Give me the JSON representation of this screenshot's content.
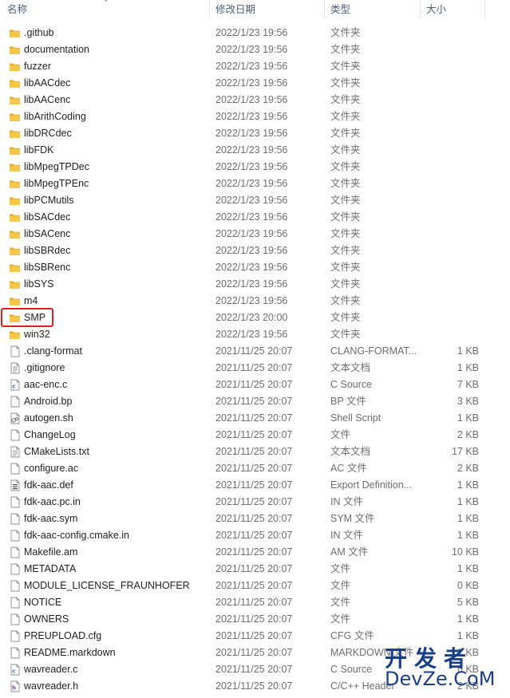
{
  "columns": {
    "name": "名称",
    "modified": "修改日期",
    "type": "类型",
    "size": "大小"
  },
  "files": [
    {
      "name": ".github",
      "date": "2022/1/23 19:56",
      "type": "文件夹",
      "size": "",
      "icon": "folder-icon"
    },
    {
      "name": "documentation",
      "date": "2022/1/23 19:56",
      "type": "文件夹",
      "size": "",
      "icon": "folder-icon"
    },
    {
      "name": "fuzzer",
      "date": "2022/1/23 19:56",
      "type": "文件夹",
      "size": "",
      "icon": "folder-icon"
    },
    {
      "name": "libAACdec",
      "date": "2022/1/23 19:56",
      "type": "文件夹",
      "size": "",
      "icon": "folder-icon"
    },
    {
      "name": "libAACenc",
      "date": "2022/1/23 19:56",
      "type": "文件夹",
      "size": "",
      "icon": "folder-icon"
    },
    {
      "name": "libArithCoding",
      "date": "2022/1/23 19:56",
      "type": "文件夹",
      "size": "",
      "icon": "folder-icon"
    },
    {
      "name": "libDRCdec",
      "date": "2022/1/23 19:56",
      "type": "文件夹",
      "size": "",
      "icon": "folder-icon"
    },
    {
      "name": "libFDK",
      "date": "2022/1/23 19:56",
      "type": "文件夹",
      "size": "",
      "icon": "folder-icon"
    },
    {
      "name": "libMpegTPDec",
      "date": "2022/1/23 19:56",
      "type": "文件夹",
      "size": "",
      "icon": "folder-icon"
    },
    {
      "name": "libMpegTPEnc",
      "date": "2022/1/23 19:56",
      "type": "文件夹",
      "size": "",
      "icon": "folder-icon"
    },
    {
      "name": "libPCMutils",
      "date": "2022/1/23 19:56",
      "type": "文件夹",
      "size": "",
      "icon": "folder-icon"
    },
    {
      "name": "libSACdec",
      "date": "2022/1/23 19:56",
      "type": "文件夹",
      "size": "",
      "icon": "folder-icon"
    },
    {
      "name": "libSACenc",
      "date": "2022/1/23 19:56",
      "type": "文件夹",
      "size": "",
      "icon": "folder-icon"
    },
    {
      "name": "libSBRdec",
      "date": "2022/1/23 19:56",
      "type": "文件夹",
      "size": "",
      "icon": "folder-icon"
    },
    {
      "name": "libSBRenc",
      "date": "2022/1/23 19:56",
      "type": "文件夹",
      "size": "",
      "icon": "folder-icon"
    },
    {
      "name": "libSYS",
      "date": "2022/1/23 19:56",
      "type": "文件夹",
      "size": "",
      "icon": "folder-icon"
    },
    {
      "name": "m4",
      "date": "2022/1/23 19:56",
      "type": "文件夹",
      "size": "",
      "icon": "folder-icon"
    },
    {
      "name": "SMP",
      "date": "2022/1/23 20:00",
      "type": "文件夹",
      "size": "",
      "icon": "folder-icon",
      "highlighted": true
    },
    {
      "name": "win32",
      "date": "2022/1/23 19:56",
      "type": "文件夹",
      "size": "",
      "icon": "folder-icon"
    },
    {
      "name": ".clang-format",
      "date": "2021/11/25 20:07",
      "type": "CLANG-FORMAT...",
      "size": "1 KB",
      "icon": "file-icon"
    },
    {
      "name": ".gitignore",
      "date": "2021/11/25 20:07",
      "type": "文本文档",
      "size": "1 KB",
      "icon": "text-file-icon"
    },
    {
      "name": "aac-enc.c",
      "date": "2021/11/25 20:07",
      "type": "C Source",
      "size": "7 KB",
      "icon": "c-source-icon"
    },
    {
      "name": "Android.bp",
      "date": "2021/11/25 20:07",
      "type": "BP 文件",
      "size": "3 KB",
      "icon": "file-icon"
    },
    {
      "name": "autogen.sh",
      "date": "2021/11/25 20:07",
      "type": "Shell Script",
      "size": "1 KB",
      "icon": "shell-script-icon"
    },
    {
      "name": "ChangeLog",
      "date": "2021/11/25 20:07",
      "type": "文件",
      "size": "2 KB",
      "icon": "file-icon"
    },
    {
      "name": "CMakeLists.txt",
      "date": "2021/11/25 20:07",
      "type": "文本文档",
      "size": "17 KB",
      "icon": "text-file-icon"
    },
    {
      "name": "configure.ac",
      "date": "2021/11/25 20:07",
      "type": "AC 文件",
      "size": "2 KB",
      "icon": "file-icon"
    },
    {
      "name": "fdk-aac.def",
      "date": "2021/11/25 20:07",
      "type": "Export Definition...",
      "size": "1 KB",
      "icon": "def-file-icon"
    },
    {
      "name": "fdk-aac.pc.in",
      "date": "2021/11/25 20:07",
      "type": "IN 文件",
      "size": "1 KB",
      "icon": "file-icon"
    },
    {
      "name": "fdk-aac.sym",
      "date": "2021/11/25 20:07",
      "type": "SYM 文件",
      "size": "1 KB",
      "icon": "file-icon"
    },
    {
      "name": "fdk-aac-config.cmake.in",
      "date": "2021/11/25 20:07",
      "type": "IN 文件",
      "size": "1 KB",
      "icon": "file-icon"
    },
    {
      "name": "Makefile.am",
      "date": "2021/11/25 20:07",
      "type": "AM 文件",
      "size": "10 KB",
      "icon": "file-icon"
    },
    {
      "name": "METADATA",
      "date": "2021/11/25 20:07",
      "type": "文件",
      "size": "1 KB",
      "icon": "file-icon"
    },
    {
      "name": "MODULE_LICENSE_FRAUNHOFER",
      "date": "2021/11/25 20:07",
      "type": "文件",
      "size": "0 KB",
      "icon": "file-icon"
    },
    {
      "name": "NOTICE",
      "date": "2021/11/25 20:07",
      "type": "文件",
      "size": "5 KB",
      "icon": "file-icon"
    },
    {
      "name": "OWNERS",
      "date": "2021/11/25 20:07",
      "type": "文件",
      "size": "1 KB",
      "icon": "file-icon"
    },
    {
      "name": "PREUPLOAD.cfg",
      "date": "2021/11/25 20:07",
      "type": "CFG 文件",
      "size": "1 KB",
      "icon": "file-icon"
    },
    {
      "name": "README.markdown",
      "date": "2021/11/25 20:07",
      "type": "MARKDOWN 文件",
      "size": "1 KB",
      "icon": "file-icon"
    },
    {
      "name": "wavreader.c",
      "date": "2021/11/25 20:07",
      "type": "C Source",
      "size": "6 KB",
      "icon": "c-source-icon"
    },
    {
      "name": "wavreader.h",
      "date": "2021/11/25 20:07",
      "type": "C/C++ Header",
      "size": "2 KB",
      "icon": "c-header-icon"
    }
  ],
  "watermark": {
    "line1": "开发者",
    "line2": "DevZe.CoM"
  },
  "colors": {
    "folder": "#f5c84c",
    "folder_dark": "#e0a92a",
    "highlight_border": "#e02020",
    "watermark": "#1a3f8a"
  }
}
